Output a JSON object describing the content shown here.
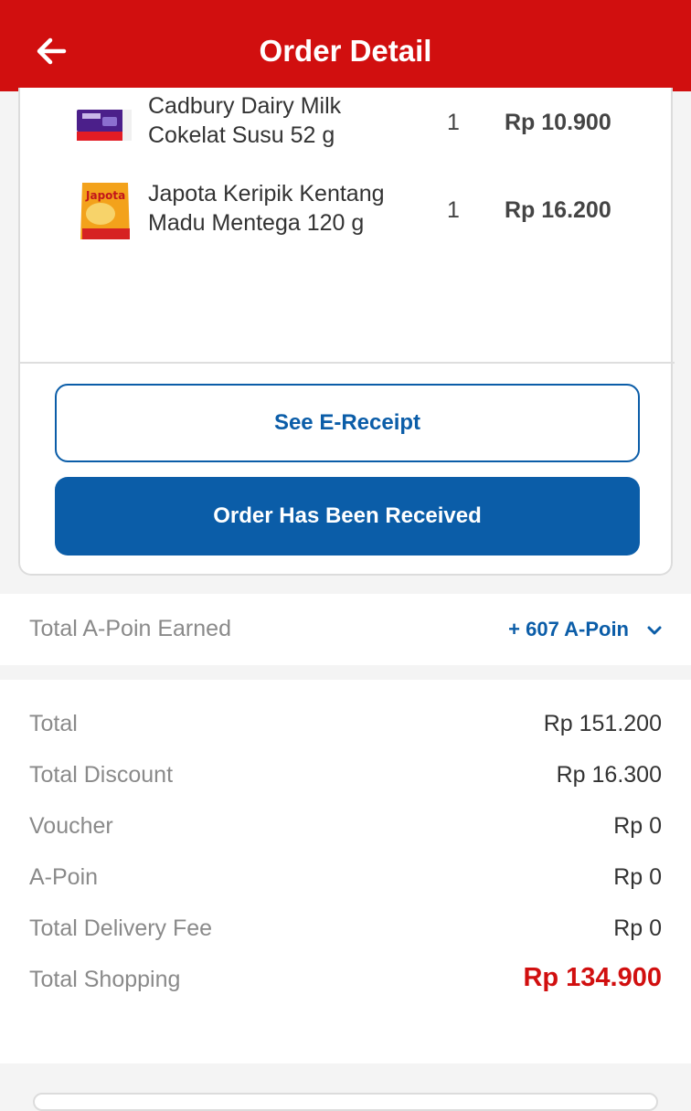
{
  "header": {
    "title": "Order Detail",
    "back_icon": "arrow-left-icon",
    "color": "#d10f0f"
  },
  "items": [
    {
      "name_line1": "Cadbury Dairy Milk",
      "name_line2": "Cokelat Susu 52 g",
      "qty": "1",
      "price": "Rp 10.900",
      "thumb_icon": "cadbury-product-icon"
    },
    {
      "name_line1": "Japota Keripik Kentang",
      "name_line2": "Madu Mentega 120 g",
      "qty": "1",
      "price": "Rp 16.200",
      "thumb_icon": "japota-product-icon"
    }
  ],
  "buttons": {
    "see_receipt": "See E-Receipt",
    "order_received": "Order Has Been Received",
    "accent": "#0b5da8"
  },
  "apoin": {
    "label": "Total A-Poin Earned",
    "value": "+ 607 A-Poin",
    "chevron_icon": "chevron-down-icon"
  },
  "summary": {
    "total_label": "Total",
    "total_value": "Rp 151.200",
    "discount_label": "Total Discount",
    "discount_value": "Rp 16.300",
    "voucher_label": "Voucher",
    "voucher_value": "Rp 0",
    "apoin_label": "A-Poin",
    "apoin_value": "Rp 0",
    "delivery_label": "Total Delivery Fee",
    "delivery_value": "Rp 0",
    "shopping_label": "Total Shopping",
    "shopping_value": "Rp 134.900",
    "total_color": "#d10f0f"
  }
}
